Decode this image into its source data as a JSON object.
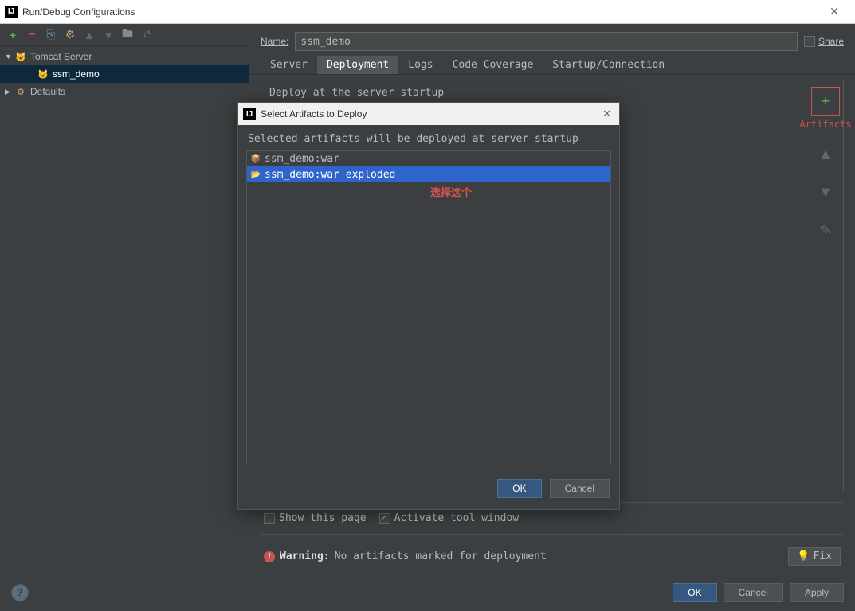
{
  "window": {
    "title": "Run/Debug Configurations"
  },
  "toolbar": {
    "add": "+",
    "remove": "−",
    "copy": "⎘",
    "settings": "⚙",
    "up": "▲",
    "down": "▼",
    "folder": "🖿",
    "sort": "↓ᴬ"
  },
  "tree": {
    "tomcat_label": "Tomcat Server",
    "tomcat_child": "ssm_demo",
    "defaults_label": "Defaults"
  },
  "form": {
    "name_label": "Name:",
    "name_value": "ssm_demo",
    "share_label": "Share"
  },
  "tabs": {
    "server": "Server",
    "deployment": "Deployment",
    "logs": "Logs",
    "coverage": "Code Coverage",
    "startup": "Startup/Connection"
  },
  "content": {
    "deploy_header": "Deploy at the server startup",
    "artifacts_label": "Artifacts",
    "show_this_page": "Show this page",
    "activate_tool_window": "Activate tool window"
  },
  "warning": {
    "label": "Warning:",
    "text": "No artifacts marked for deployment",
    "fix": "Fix"
  },
  "footer": {
    "ok": "OK",
    "cancel": "Cancel",
    "apply": "Apply"
  },
  "modal": {
    "title": "Select Artifacts to Deploy",
    "hint": "Selected artifacts will be deployed at server startup",
    "items": [
      "ssm_demo:war",
      "ssm_demo:war exploded"
    ],
    "annotation": "选择这个",
    "ok": "OK",
    "cancel": "Cancel"
  }
}
